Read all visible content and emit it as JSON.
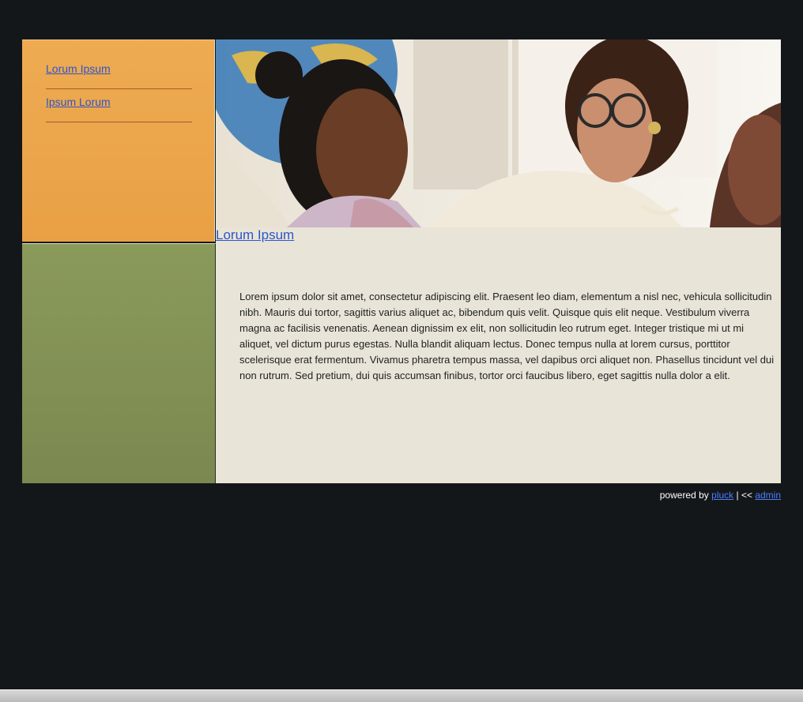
{
  "sidebar": {
    "items": [
      {
        "label": "Lorum Ipsum"
      },
      {
        "label": "Ipsum Lorum"
      }
    ]
  },
  "main": {
    "title": "Lorum Ipsum",
    "body": "Lorem ipsum dolor sit amet, consectetur adipiscing elit. Praesent leo diam, elementum a nisl nec, vehicula sollicitudin nibh. Mauris dui tortor, sagittis varius aliquet ac, bibendum quis velit. Quisque quis elit neque. Vestibulum viverra magna ac facilisis venenatis. Aenean dignissim ex elit, non sollicitudin leo rutrum eget. Integer tristique mi ut mi aliquet, vel dictum purus egestas. Nulla blandit aliquam lectus. Donec tempus nulla at lorem cursus, porttitor scelerisque erat fermentum. Vivamus pharetra tempus massa, vel dapibus orci aliquet non. Phasellus tincidunt vel dui non rutrum. Sed pretium, dui quis accumsan finibus, tortor orci faucibus libero, eget sagittis nulla dolor a elit."
  },
  "footer": {
    "powered_text": "powered by",
    "pluck_link": "pluck",
    "separator": "| <<",
    "admin_link": "admin"
  },
  "colors": {
    "background": "#13171a",
    "nav_orange": "#eba34a",
    "panel_green": "#84935a",
    "content_bg": "#e8e4d8",
    "link": "#2f55c8"
  }
}
